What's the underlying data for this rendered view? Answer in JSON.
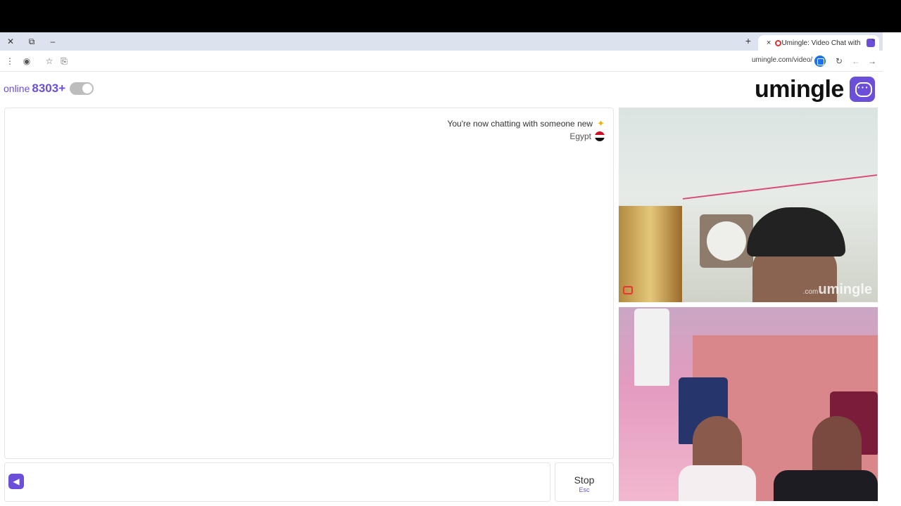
{
  "browser": {
    "tab_title": "Umingle: Video Chat with S",
    "url": "umingle.com/video/",
    "new_tab_symbol": "+",
    "close_symbol": "×"
  },
  "site": {
    "brand": "umingle",
    "brand_color": "#6b4fd8",
    "online_count": "8303+",
    "online_label": "online"
  },
  "chat": {
    "system_message": "You're now chatting with someone new",
    "country": "Egypt",
    "send_icon": "send-icon"
  },
  "controls": {
    "stop_label": "Stop",
    "stop_shortcut": "Esc"
  },
  "video": {
    "watermark_brand": "umingle",
    "watermark_suffix": ".com"
  }
}
